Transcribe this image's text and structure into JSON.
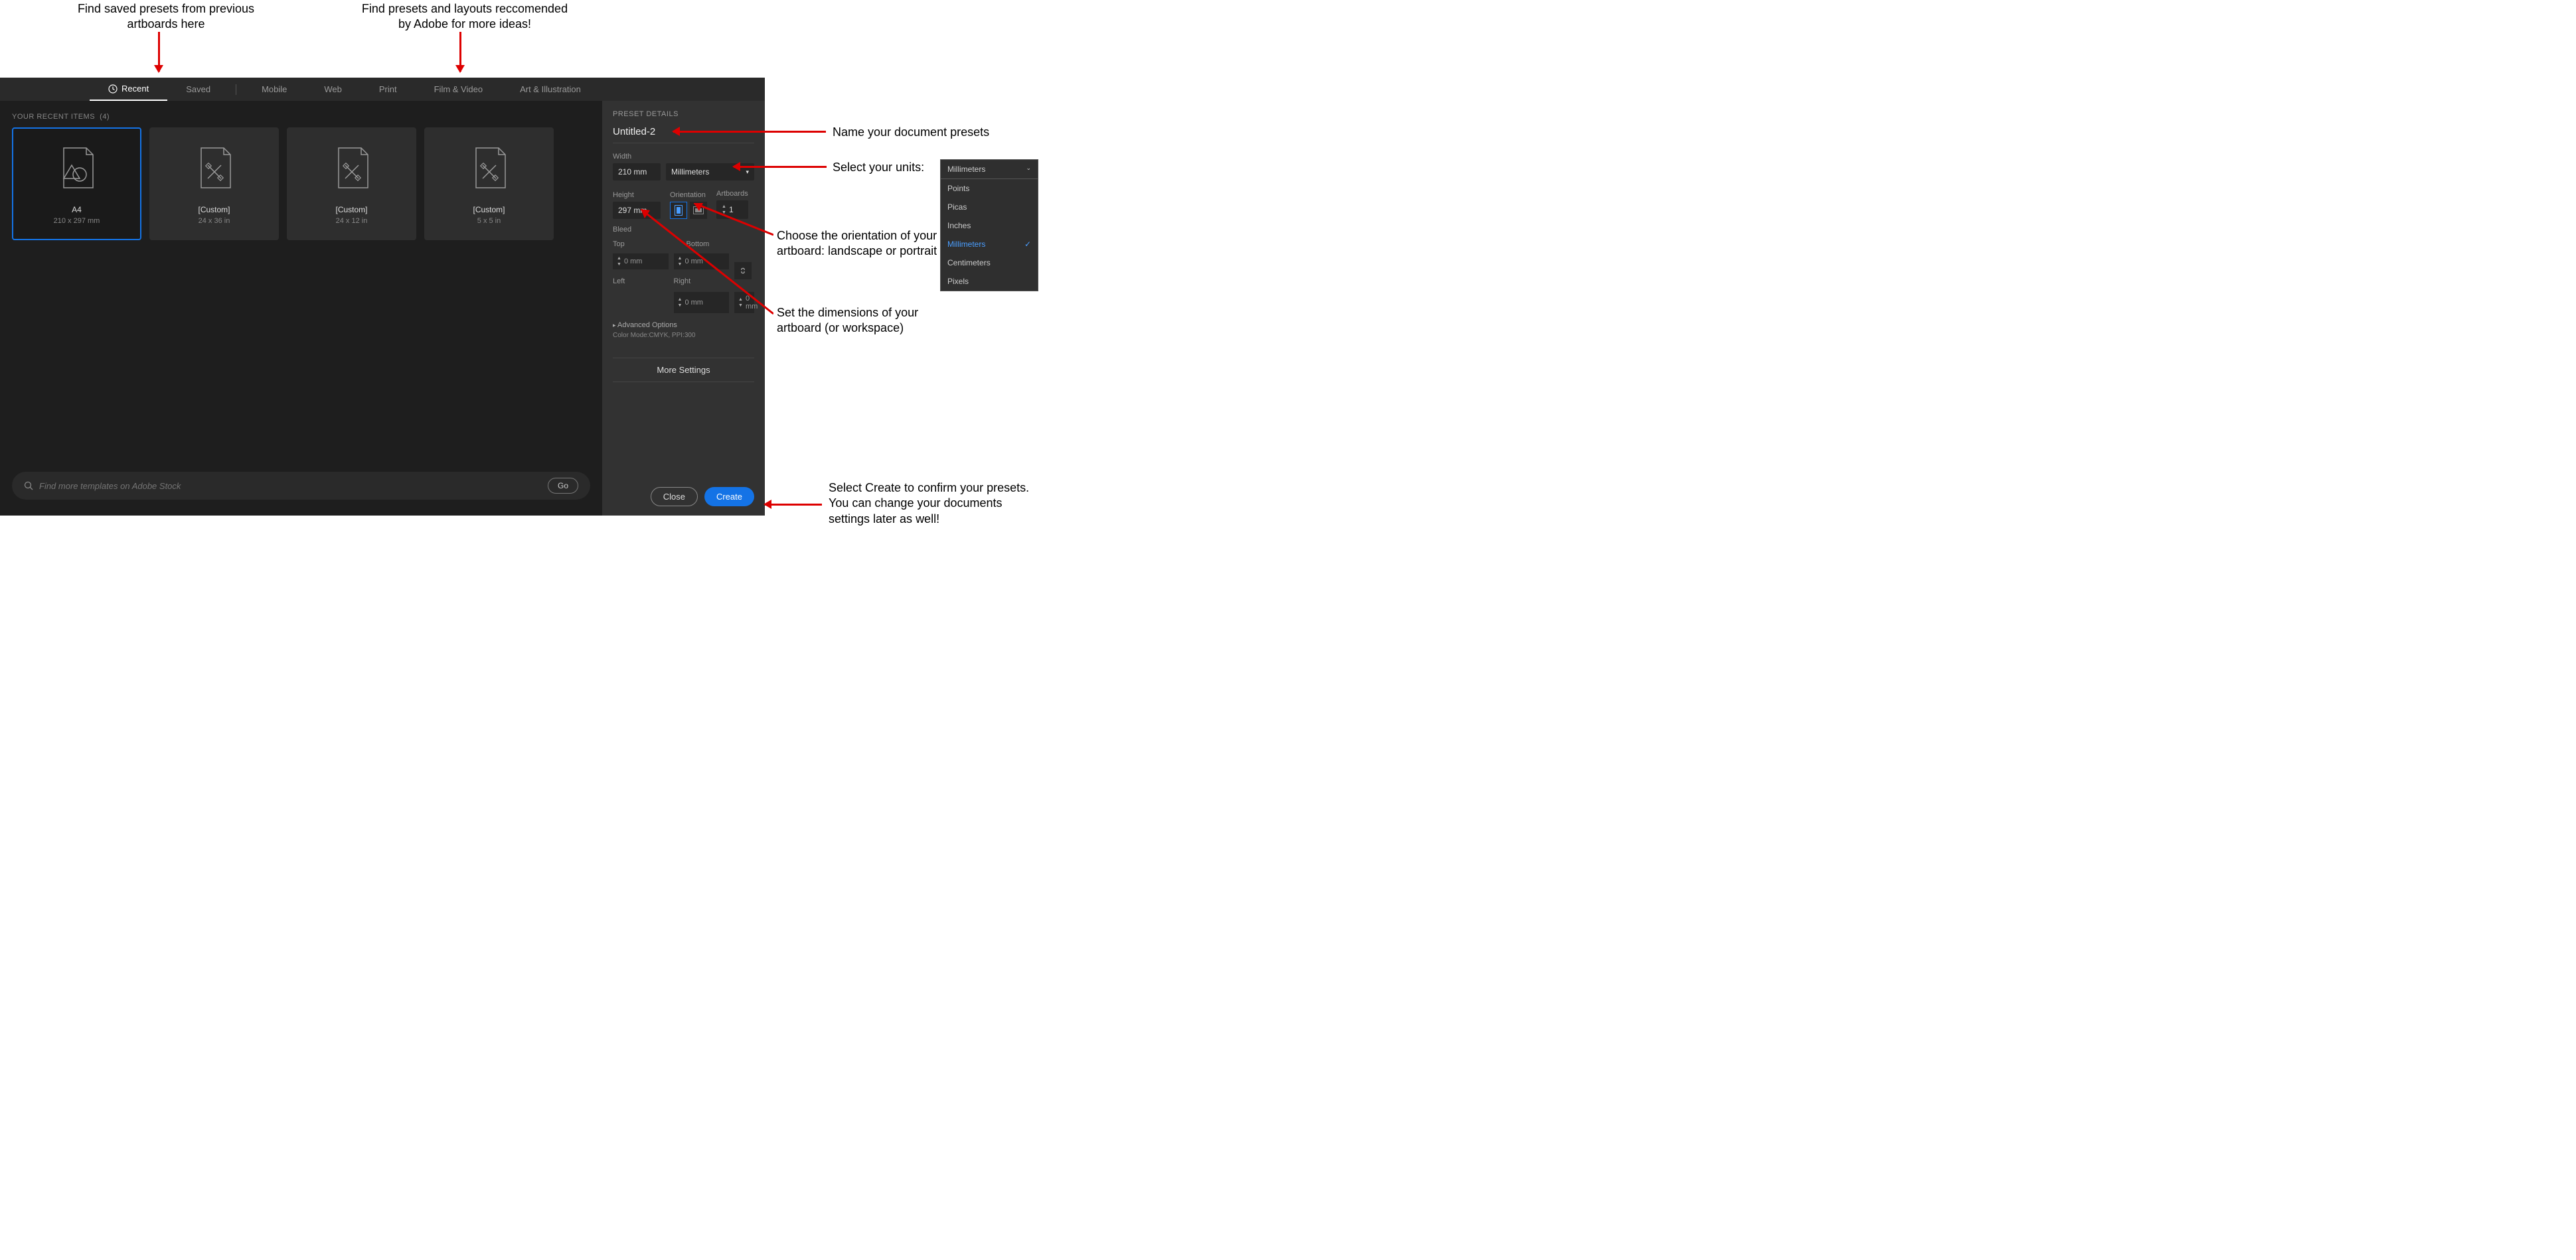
{
  "annotations": {
    "top_left": "Find saved presets from previous\nartboards here",
    "top_right": "Find presets and layouts reccomended\nby Adobe for more ideas!",
    "name": "Name your document presets",
    "units": "Select your units:",
    "orientation": "Choose the orientation of your artboard: landscape or portrait",
    "dimensions": "Set the dimensions of your artboard (or workspace)",
    "create": "Select Create to confirm your presets. You can change your documents settings later as well!"
  },
  "tabs": [
    "Recent",
    "Saved",
    "Mobile",
    "Web",
    "Print",
    "Film & Video",
    "Art & Illustration"
  ],
  "section_label": "YOUR RECENT ITEMS",
  "section_count": "(4)",
  "cards": [
    {
      "name": "A4",
      "dims": "210 x 297 mm",
      "selected": true,
      "icon": "shapes"
    },
    {
      "name": "[Custom]",
      "dims": "24 x 36 in",
      "selected": false,
      "icon": "tools"
    },
    {
      "name": "[Custom]",
      "dims": "24 x 12 in",
      "selected": false,
      "icon": "tools"
    },
    {
      "name": "[Custom]",
      "dims": "5 x 5 in",
      "selected": false,
      "icon": "tools"
    }
  ],
  "search": {
    "placeholder": "Find more templates on Adobe Stock",
    "go": "Go"
  },
  "preset": {
    "title": "PRESET DETAILS",
    "doc_name": "Untitled-2",
    "width_label": "Width",
    "width_value": "210 mm",
    "units_value": "Millimeters",
    "height_label": "Height",
    "height_value": "297 mm",
    "orientation_label": "Orientation",
    "artboards_label": "Artboards",
    "artboards_value": "1",
    "bleed_label": "Bleed",
    "top_label": "Top",
    "bottom_label": "Bottom",
    "left_label": "Left",
    "right_label": "Right",
    "bleed_value": "0 mm",
    "advanced": "Advanced Options",
    "color_mode": "Color Mode:CMYK, PPI:300",
    "more_settings": "More Settings",
    "close": "Close",
    "create": "Create"
  },
  "units_dropdown": {
    "header": "Millimeters",
    "options": [
      "Points",
      "Picas",
      "Inches",
      "Millimeters",
      "Centimeters",
      "Pixels"
    ],
    "selected": "Millimeters"
  }
}
